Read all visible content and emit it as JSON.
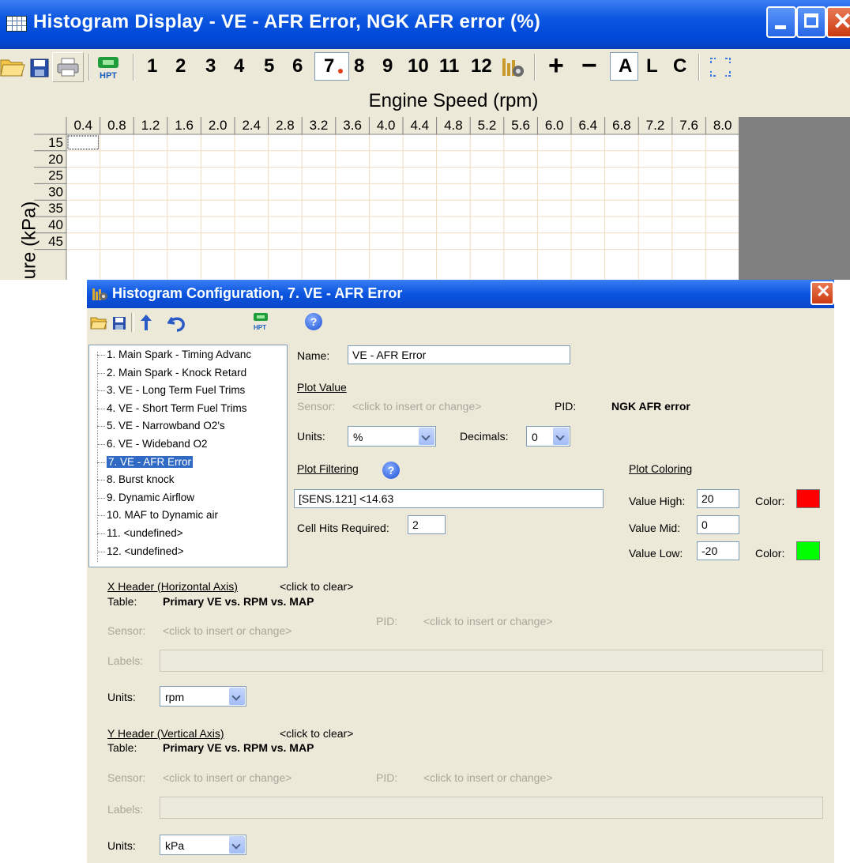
{
  "main_window": {
    "title": "Histogram Display   -   VE - AFR Error,  NGK AFR error  (%)",
    "toolbar": {
      "numbers": [
        "1",
        "2",
        "3",
        "4",
        "5",
        "6",
        "7",
        "8",
        "9",
        "10",
        "11",
        "12"
      ],
      "selected": "7",
      "plus": "+",
      "minus": "−",
      "letters": [
        "A",
        "L",
        "C"
      ]
    },
    "x_axis_title": "Engine Speed (rpm)",
    "y_axis_title": "ure  (kPa)",
    "columns": [
      "0.4",
      "0.8",
      "1.2",
      "1.6",
      "2.0",
      "2.4",
      "2.8",
      "3.2",
      "3.6",
      "4.0",
      "4.4",
      "4.8",
      "5.2",
      "5.6",
      "6.0",
      "6.4",
      "6.8",
      "7.2",
      "7.6",
      "8.0"
    ],
    "rows": [
      "15",
      "20",
      "25",
      "30",
      "35",
      "40",
      "45"
    ]
  },
  "config_dialog": {
    "title": "Histogram Configuration,  7. VE - AFR Error",
    "tree_items": [
      "1. Main Spark - Timing Advanc",
      "2. Main Spark - Knock Retard",
      "3. VE - Long Term Fuel Trims",
      "4. VE - Short Term Fuel Trims",
      "5. VE - Narrowband O2's",
      "6. VE - Wideband O2",
      "7. VE - AFR Error",
      "8. Burst knock",
      "9. Dynamic Airflow",
      "10. MAF to Dynamic air",
      "11. <undefined>",
      "12. <undefined>"
    ],
    "selected_tree_index": 6,
    "name_label": "Name:",
    "name_value": "VE - AFR Error",
    "plot_value_heading": "Plot Value",
    "sensor_label": "Sensor:",
    "sensor_hint": "<click to insert or change>",
    "pid_label": "PID:",
    "pid_value": "NGK AFR error",
    "units_label": "Units:",
    "units_value": "%",
    "decimals_label": "Decimals:",
    "decimals_value": "0",
    "plot_filtering_heading": "Plot Filtering",
    "filter_value": "[SENS.121] <14.63",
    "cell_hits_label": "Cell Hits Required:",
    "cell_hits_value": "2",
    "plot_coloring_heading": "Plot Coloring",
    "value_high_label": "Value High:",
    "value_high": "20",
    "value_mid_label": "Value Mid:",
    "value_mid": "0",
    "value_low_label": "Value Low:",
    "value_low": "-20",
    "color_label": "Color:",
    "color_high": "#ff0000",
    "color_low": "#00ff00",
    "x_header": {
      "heading": "X Header (Horizontal Axis)",
      "clear": "<click to clear>",
      "table_label": "Table:",
      "table_value": "Primary VE vs. RPM vs. MAP",
      "sensor_label": "Sensor:",
      "sensor_hint": "<click to insert or change>",
      "pid_label": "PID:",
      "pid_hint": "<click to insert or change>",
      "labels_label": "Labels:",
      "units_label": "Units:",
      "units_value": "rpm"
    },
    "y_header": {
      "heading": "Y Header (Vertical Axis)",
      "clear": "<click to clear>",
      "table_label": "Table:",
      "table_value": "Primary VE vs. RPM vs. MAP",
      "sensor_label": "Sensor:",
      "sensor_hint": "<click to insert or change>",
      "pid_label": "PID:",
      "pid_hint": "<click to insert or change>",
      "labels_label": "Labels:",
      "units_label": "Units:",
      "units_value": "kPa"
    }
  }
}
